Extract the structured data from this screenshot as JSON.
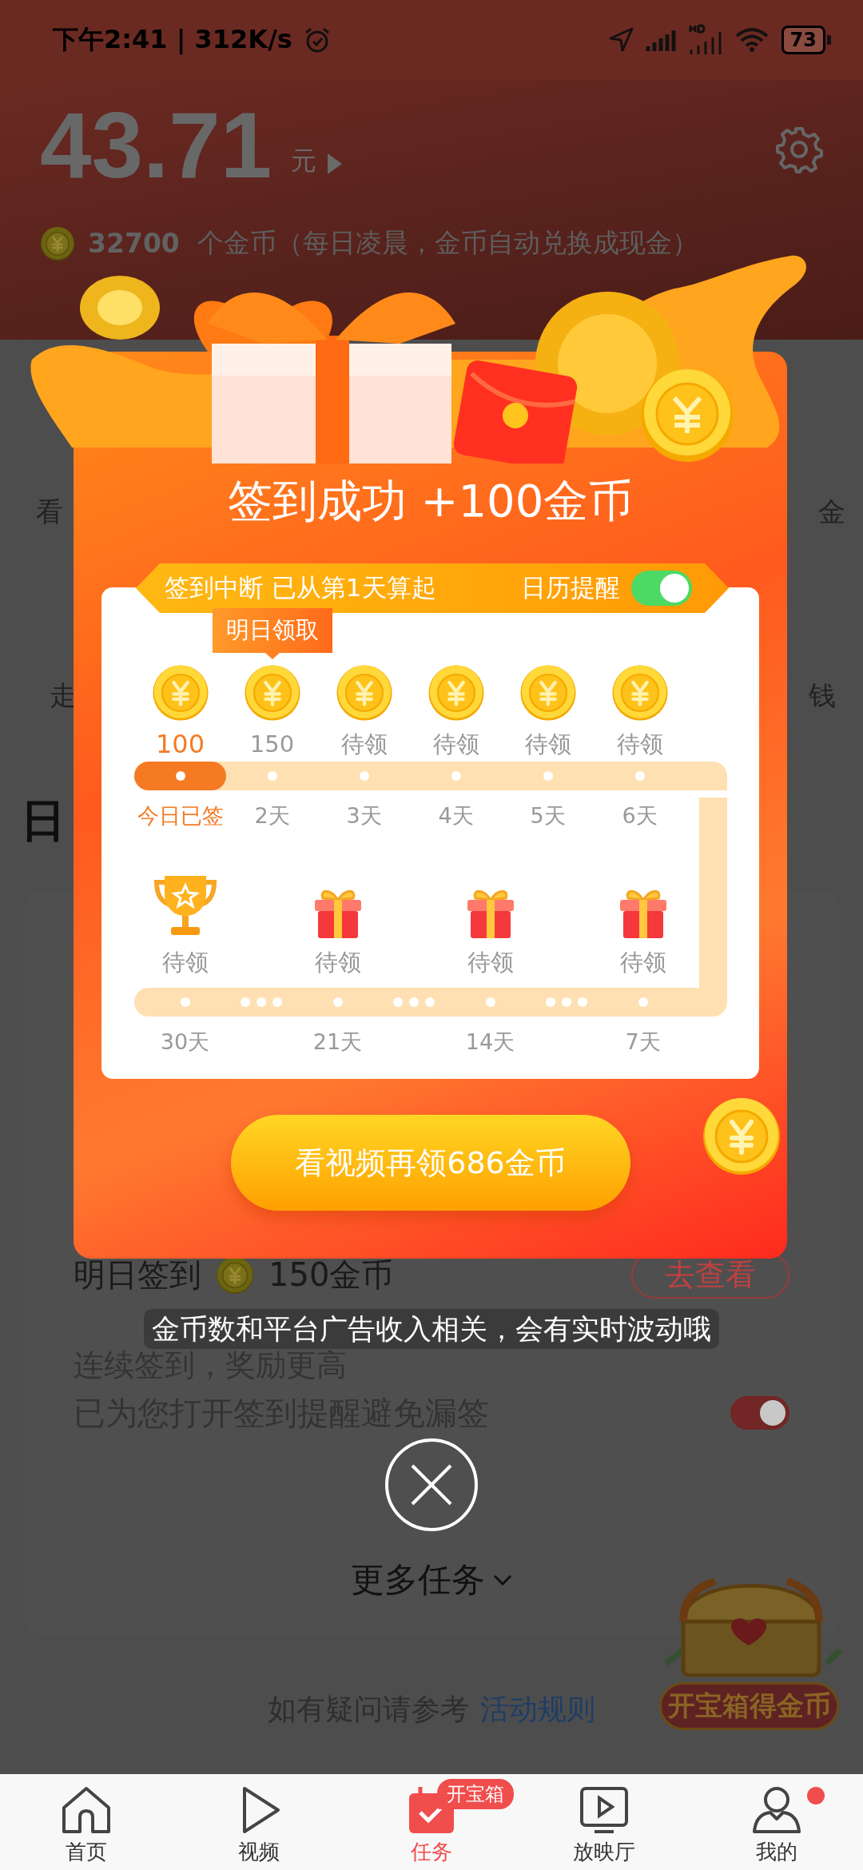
{
  "status_bar": {
    "time": "下午2:41 | 312K/s",
    "battery": "73"
  },
  "header": {
    "balance": "43.71",
    "unit": "元",
    "coins": "32700",
    "coins_note": "个金币（每日凌晨，金币自动兑换成现金）"
  },
  "task_rows": [
    {
      "left": "看",
      "right": "金"
    },
    {
      "left": "走",
      "right": "钱"
    }
  ],
  "section_title": "日",
  "signin_card": {
    "title": "明日签到",
    "reward": "150金币",
    "button": "去查看",
    "subtitle": "连续签到，奖励更高",
    "reminder": "已为您打开签到提醒避免漏签",
    "reminder_on": true
  },
  "more_tasks": "更多任务",
  "footer": {
    "text": "如有疑问请参考",
    "link": "活动规则"
  },
  "chest_label": "开宝箱得金币",
  "modal": {
    "title": "签到成功 +100金币",
    "notice": "签到中断 已从第1天算起",
    "reminder_label": "日历提醒",
    "reminder_on": true,
    "days": [
      {
        "reward": "100",
        "day": "今日已签",
        "signed": true
      },
      {
        "reward": "150",
        "day": "2天",
        "signed": false,
        "tooltip": "明日领取"
      },
      {
        "reward": "待领",
        "day": "3天",
        "signed": false
      },
      {
        "reward": "待领",
        "day": "4天",
        "signed": false
      },
      {
        "reward": "待领",
        "day": "5天",
        "signed": false
      },
      {
        "reward": "待领",
        "day": "6天",
        "signed": false
      }
    ],
    "milestones": [
      {
        "kind": "trophy",
        "reward": "待领",
        "day": "30天"
      },
      {
        "kind": "gift",
        "reward": "待领",
        "day": "21天"
      },
      {
        "kind": "gift",
        "reward": "待领",
        "day": "14天"
      },
      {
        "kind": "gift",
        "reward": "待领",
        "day": "7天"
      }
    ],
    "button": "看视频再领686金币"
  },
  "toast": "金币数和平台广告收入相关，会有实时波动哦",
  "nav": [
    {
      "kind": "home",
      "label": "首页",
      "selected": false
    },
    {
      "kind": "play",
      "label": "视频",
      "selected": false
    },
    {
      "kind": "tasks",
      "label": "任务",
      "selected": true,
      "badge": "开宝箱"
    },
    {
      "kind": "screen",
      "label": "放映厅",
      "selected": false
    },
    {
      "kind": "profile",
      "label": "我的",
      "selected": false,
      "dot": true
    }
  ]
}
